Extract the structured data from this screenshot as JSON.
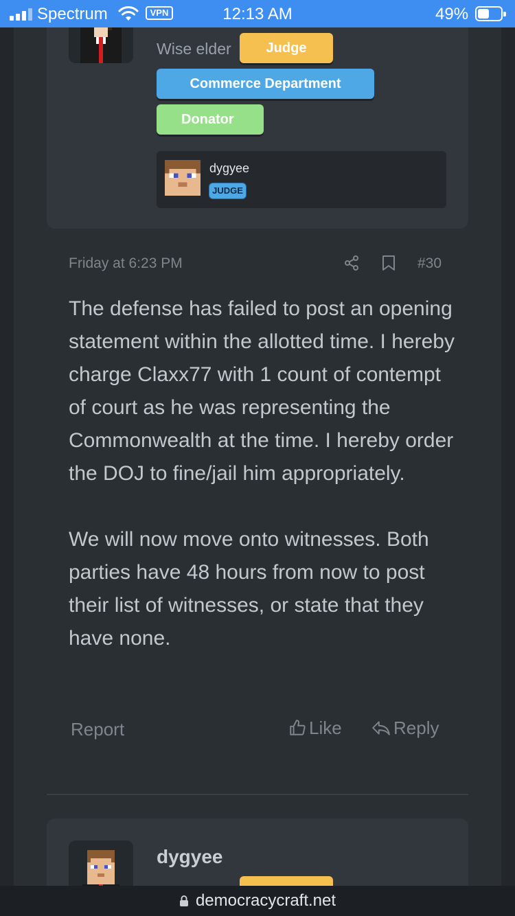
{
  "status_bar": {
    "carrier": "Spectrum",
    "vpn_label": "VPN",
    "time": "12:13 AM",
    "battery_percent": "49%",
    "battery_level": 0.49
  },
  "first_user": {
    "user_title": "Wise elder",
    "banners": {
      "judge": "Judge",
      "commerce": "Commerce Department",
      "donator": "Donator"
    },
    "mini_card": {
      "name": "dygyee",
      "badge": "JUDGE"
    }
  },
  "post": {
    "date": "Friday at 6:23 PM",
    "number": "#30",
    "paragraphs": [
      "The defense has failed to post an opening statement within the allotted time. I hereby charge Claxx77 with 1 count of contempt of court as he was representing the Commonwealth at the time. I hereby order the DOJ to fine/jail him appropriately.",
      "We will now move onto witnesses. Both parties have 48 hours from now to post their list of witnesses, or state that they have none."
    ],
    "actions": {
      "report": "Report",
      "like": "Like",
      "reply": "Reply"
    }
  },
  "second_user": {
    "name": "dygyee"
  },
  "url_bar": {
    "domain": "democracycraft.net"
  },
  "colors": {
    "status_bar": "#3d8ef0",
    "judge": "#f5c04f",
    "commerce": "#4fa8e6",
    "donator": "#96e08a",
    "background": "#2a2f34"
  }
}
